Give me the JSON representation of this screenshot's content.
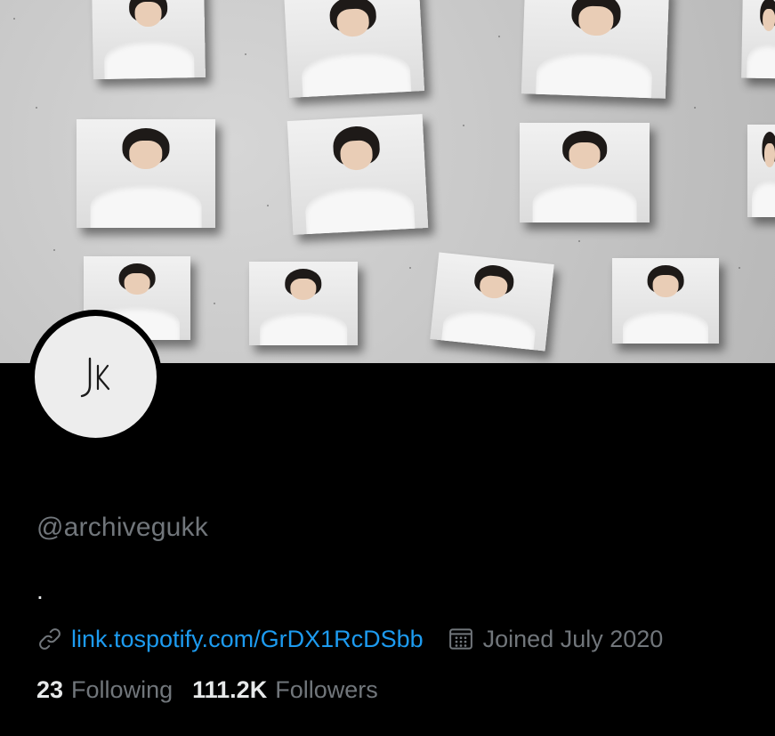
{
  "profile": {
    "handle": "@archivegukk",
    "bio": ".",
    "avatar_monogram": "JK",
    "link": "link.tospotify.com/GrDX1RcDSbb",
    "joined": "Joined July 2020",
    "following_count": "23",
    "following_label": "Following",
    "followers_count": "111.2K",
    "followers_label": "Followers"
  },
  "icons": {
    "link": "link-icon",
    "calendar": "calendar-icon"
  },
  "colors": {
    "background": "#000000",
    "link": "#1d9bf0",
    "secondary_text": "#71767b",
    "primary_text": "#e7e9ea"
  }
}
